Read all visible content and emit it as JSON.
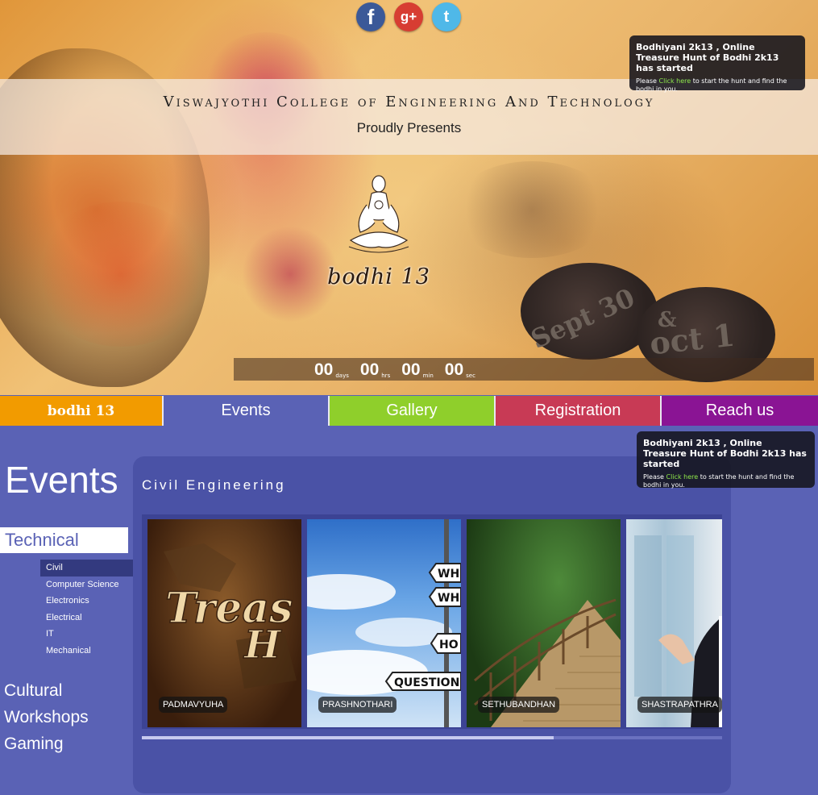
{
  "social": {
    "facebook_glyph": "f",
    "googleplus_glyph": "g+",
    "twitter_glyph": "t"
  },
  "banner": {
    "college": "Viswajyothi College of Engineering And Technology",
    "presents": "Proudly Presents"
  },
  "logo": {
    "wordmark": "bodhi 13"
  },
  "dates": {
    "first": "Sept 30",
    "amp": "&",
    "second": "oct 1"
  },
  "countdown": [
    {
      "value": "00",
      "label": "days"
    },
    {
      "value": "00",
      "label": "hrs"
    },
    {
      "value": "00",
      "label": "min"
    },
    {
      "value": "00",
      "label": "sec"
    }
  ],
  "notice": {
    "title": "Bodhiyani 2k13 , Online Treasure Hunt of Bodhi 2k13 has started",
    "body_prefix": "Please ",
    "link": "Click here",
    "body_suffix": " to start the hunt and find the bodhi in you."
  },
  "nav": [
    {
      "label": "bodhi 13",
      "color": "#f29b00"
    },
    {
      "label": "Events",
      "color": "#5a62b5"
    },
    {
      "label": "Gallery",
      "color": "#8fcf2b"
    },
    {
      "label": "Registration",
      "color": "#c83a55"
    },
    {
      "label": "Reach us",
      "color": "#8a1494"
    }
  ],
  "events": {
    "heading": "Events",
    "categories": {
      "technical": "Technical",
      "cultural": "Cultural",
      "workshops": "Workshops",
      "gaming": "Gaming"
    },
    "subcategories": [
      "Civil",
      "Computer Science",
      "Electronics",
      "Electrical",
      "IT",
      "Mechanical"
    ],
    "active_subcategory": "Civil",
    "panel_title": "Civil Engineering",
    "cards": [
      {
        "caption": "PADMAVYUHA",
        "art_text": "Treas... H"
      },
      {
        "caption": "PRASHNOTHARI",
        "art_signs": [
          "WH",
          "WH",
          "HO",
          "QUESTION"
        ]
      },
      {
        "caption": "SETHUBANDHAN"
      },
      {
        "caption": "SHASTRAPATHRA"
      }
    ],
    "scroll_position": 0.71
  }
}
